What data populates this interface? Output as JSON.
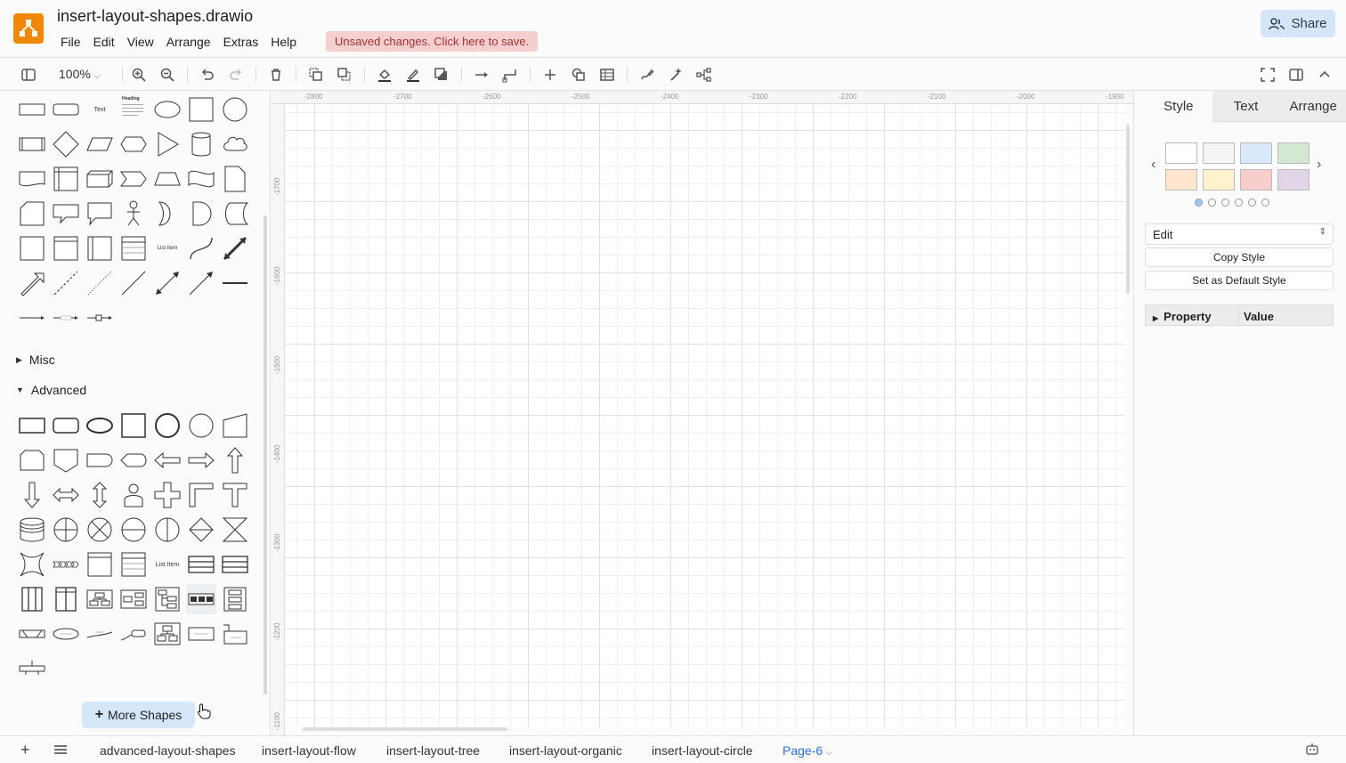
{
  "app": {
    "title": "insert-layout-shapes.drawio",
    "unsaved_notice": "Unsaved changes. Click here to save.",
    "share_label": "Share"
  },
  "menu": [
    "File",
    "Edit",
    "View",
    "Arrange",
    "Extras",
    "Help"
  ],
  "toolbar": {
    "zoom": "100%",
    "icons": [
      "format-panel-toggle-icon",
      "zoom-in-icon",
      "zoom-out-icon",
      "undo-icon",
      "redo-icon",
      "delete-icon",
      "to-front-icon",
      "to-back-icon",
      "fill-color-icon",
      "line-color-icon",
      "shadow-icon",
      "connection-icon",
      "waypoints-icon",
      "insert-icon",
      "shapes-icon",
      "table-icon",
      "freehand-icon",
      "ai-generate-icon",
      "layout-icon",
      "fullscreen-icon",
      "toggle-format-icon",
      "collapse-icon"
    ]
  },
  "sidebar": {
    "misc_label": "Misc",
    "advanced_label": "Advanced",
    "more_shapes_label": "More Shapes",
    "general_text_labels": {
      "text": "Text",
      "heading": "Heading",
      "list_item": "List Item"
    },
    "advanced_text_labels": {
      "list_item": "List Item"
    }
  },
  "ruler": {
    "top": [
      "-2800",
      "-2700",
      "-2600",
      "-2500",
      "-2400",
      "-2300",
      "-2200",
      "-2100",
      "-2000",
      "-1900"
    ],
    "left": [
      "-1700",
      "-1600",
      "-1500",
      "-1400",
      "-1300",
      "-1200",
      "-1100"
    ]
  },
  "format_panel": {
    "tabs": [
      "Style",
      "Text",
      "Arrange"
    ],
    "swatch_colors": [
      "#ffffff",
      "#f5f5f5",
      "#dae8fc",
      "#d5e8d4",
      "#ffe6cc",
      "#fff2cc",
      "#f8cecc",
      "#e1d5e7"
    ],
    "edit_label": "Edit",
    "copy_style_label": "Copy Style",
    "set_default_label": "Set as Default Style",
    "property_header": "Property",
    "value_header": "Value"
  },
  "pages": {
    "tabs": [
      "advanced-layout-shapes",
      "insert-layout-flow",
      "insert-layout-tree",
      "insert-layout-organic",
      "insert-layout-circle",
      "Page-6"
    ],
    "active": "Page-6"
  }
}
